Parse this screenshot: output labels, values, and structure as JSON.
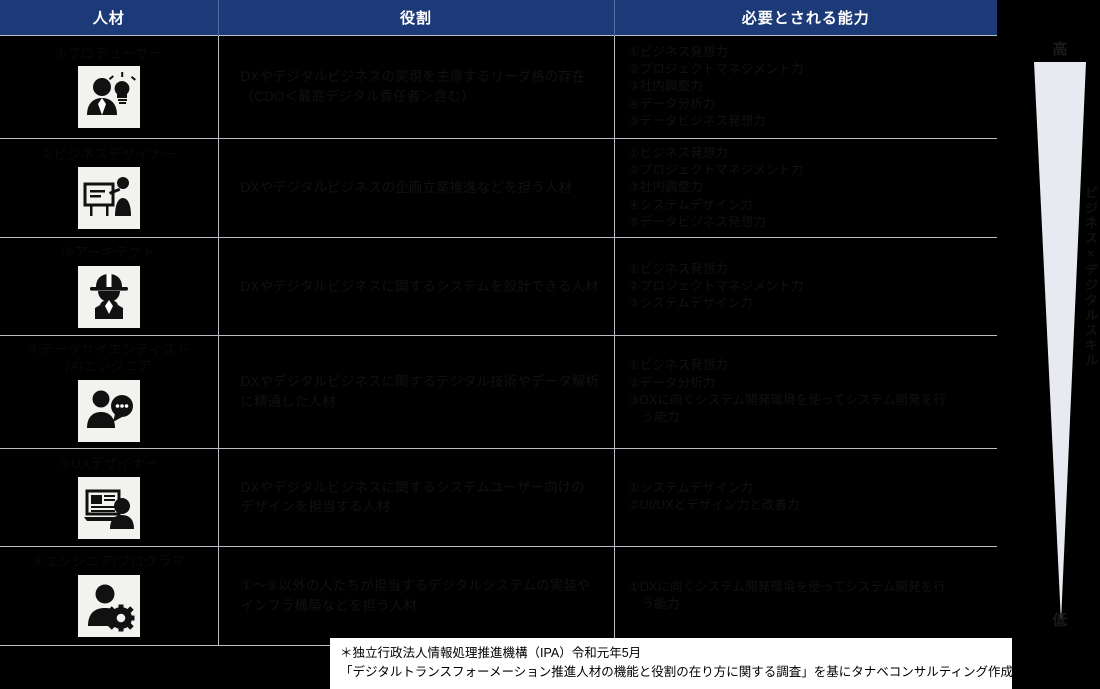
{
  "table": {
    "columns": [
      {
        "label": "人材"
      },
      {
        "label": "役割"
      },
      {
        "label": "必要とされる能力"
      }
    ],
    "rows": [
      {
        "person": "①プロデューサー",
        "icon": "person-lightbulb-icon",
        "role": "DXやデジタルビジネスの実現を主導するリーダ格の存在\n（CDO＜最高デジタル責任者＞含む）",
        "skills": [
          "①ビジネス発想力",
          "②プロジェクトマネジメント力",
          "③社内調整力",
          "④データ分析力",
          "⑤データビジネス発想力"
        ]
      },
      {
        "person": "②ビジネスデザイナー",
        "icon": "presenter-whiteboard-icon",
        "role": "DXやデジタルビジネスの企画立案推進などを担う人材",
        "skills": [
          "①ビジネス発想力",
          "②プロジェクトマネジメント力",
          "③社内調整力",
          "④システムデザイン力",
          "⑤データビジネス発想力"
        ]
      },
      {
        "person": "③アーキテクト",
        "icon": "hardhat-worker-icon",
        "role": "DXやデジタルビジネスに関するシステムを設計できる人材",
        "skills": [
          "①ビジネス発想力",
          "②プロジェクトマネジメント力",
          "③システムデザイン力"
        ]
      },
      {
        "person": "④データサイエンティスト\n/AIエンジニア",
        "icon": "person-chat-bubble-icon",
        "role": "DXやデジタルビジネスに関するデジタル技術やデータ解析\nに精通した人材",
        "skills": [
          "①ビジネス発想力",
          "②データ分析力",
          "③DXに向くシステム開発環境を使ってシステム開発を行\n   う能力"
        ]
      },
      {
        "person": "⑤UXデザイナー",
        "icon": "laptop-user-icon",
        "role": "DXやデジタルビジネスに関するシステムユーザー向けの\nデザインを担当する人材",
        "skills": [
          "①システムデザイン力",
          "②UI/UXとデザイン力と改善力"
        ]
      },
      {
        "person": "⑥エンジニア/プログラマ",
        "icon": "person-gear-icon",
        "role": "①〜⑤以外の人たちが担当するデジタルシステムの実装や\nインフラ構築などを担う人材",
        "skills": [
          "①DXに向くシステム開発環境を使ってシステム開発を行\n   う能力"
        ]
      }
    ]
  },
  "gauge": {
    "top_label": "高",
    "bottom_label": "低",
    "axis_label": "ビジネス×デジタルスキル",
    "fill_color": "#e7eaf0"
  },
  "footer": {
    "line1": "＊独立行政法人情報処理推進機構（IPA）令和元年5月",
    "line2": "「デジタルトランスフォーメーション推進人材の機能と役割の在り方に関する調査」を基にタナベコンサルティング作成"
  },
  "colors": {
    "header_blue": "#1b3a77",
    "body_black": "#000000",
    "grid_line": "#b9bcc2"
  }
}
